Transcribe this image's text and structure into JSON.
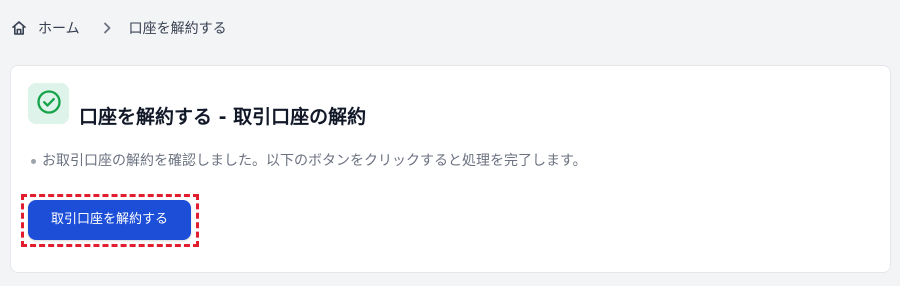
{
  "breadcrumb": {
    "home_icon": "home-icon",
    "home_label": "ホーム",
    "separator_icon": "chevron-right-icon",
    "current_label": "口座を解約する"
  },
  "card": {
    "title_icon": "check-circle-icon",
    "title": "口座を解約する - 取引口座の解約",
    "messages": [
      "お取引口座の解約を確認しました。以下のボタンをクリックすると処理を完了します。"
    ],
    "primary_button_label": "取引口座を解約する"
  },
  "colors": {
    "page_background": "#f3f4f6",
    "card_background": "#ffffff",
    "success_icon": "#16a34a",
    "success_icon_background": "#def3e9",
    "primary_button": "#1d4ed8",
    "highlight_border": "#e11d2e"
  }
}
